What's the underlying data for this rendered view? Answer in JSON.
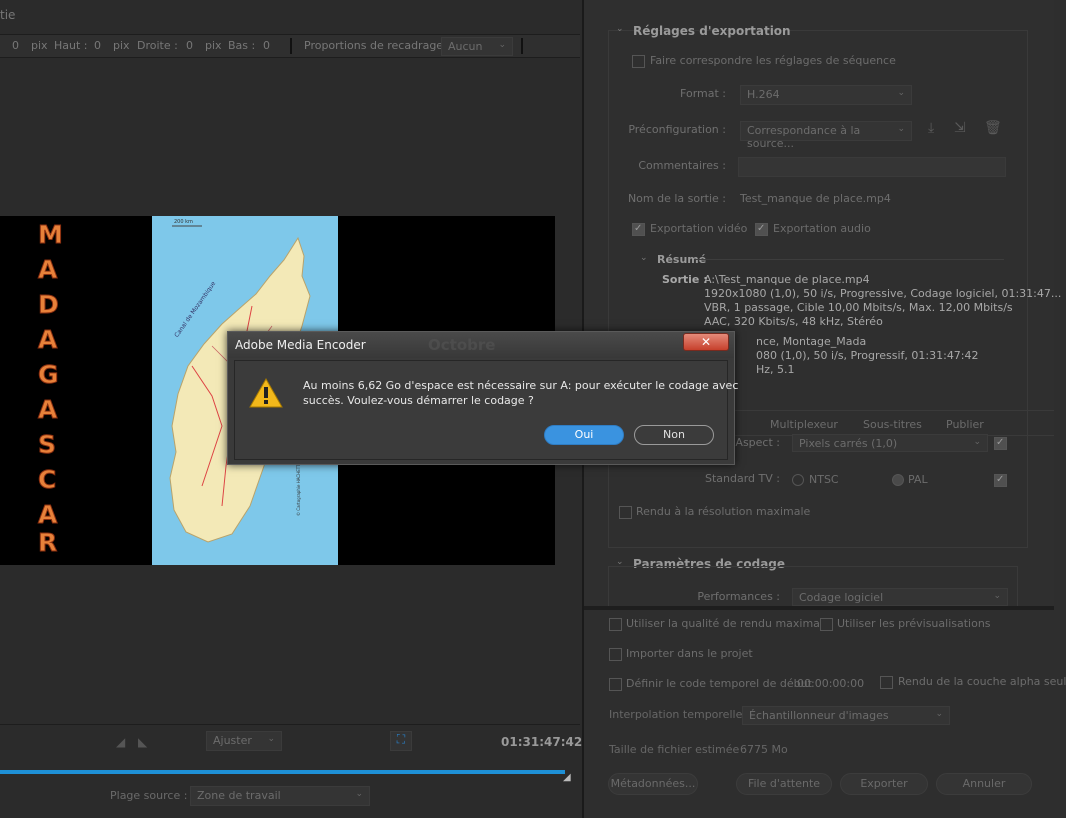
{
  "left_panel": {
    "title_fragment": "tie",
    "crop": {
      "left_value": "0",
      "unit": "pix",
      "top_label": "Haut :",
      "top_value": "0",
      "right_label": "Droite :",
      "right_value": "0",
      "bottom_label": "Bas :",
      "bottom_value": "0",
      "proportions_label": "Proportions de recadrage :",
      "proportions_value": "Aucun"
    },
    "poster_letters": [
      "M",
      "A",
      "D",
      "A",
      "G",
      "A",
      "S",
      "C",
      "A",
      "R"
    ],
    "map_scale_label": "200 km",
    "map_sea_label": "Canal de Mozambique",
    "map_credit": "© Cartographie HACHETTE Tourisme",
    "controls": {
      "fit_value": "Ajuster",
      "timecode": "01:31:47:42",
      "source_range_label": "Plage source :",
      "source_range_value": "Zone de travail"
    }
  },
  "export_settings": {
    "section_title": "Réglages d'exportation",
    "match_sequence_label": "Faire correspondre les réglages de séquence",
    "format_label": "Format :",
    "format_value": "H.264",
    "preset_label": "Préconfiguration :",
    "preset_value": "Correspondance à la source...",
    "comments_label": "Commentaires :",
    "output_name_label": "Nom de la sortie :",
    "output_name_value": "Test_manque de place.mp4",
    "export_video_label": "Exportation vidéo",
    "export_audio_label": "Exportation audio",
    "summary_title": "Résumé",
    "output_label": "Sortie :",
    "output_lines": [
      "A:\\Test_manque de place.mp4",
      "1920x1080 (1,0), 50 i/s, Progressive, Codage logiciel, 01:31:47...",
      "VBR, 1 passage, Cible 10,00  Mbits/s, Max. 12,00  Mbits/s",
      "AAC, 320  Kbits/s, 48  kHz, Stéréo"
    ],
    "source_lines": [
      "nce, Montage_Mada",
      "080 (1,0), 50  i/s, Progressif, 01:31:47:42",
      "Hz, 5.1"
    ],
    "tabs": [
      "Multiplexeur",
      "Sous-titres",
      "Publier"
    ],
    "aspect_label": "Aspect :",
    "aspect_value": "Pixels carrés (1,0)",
    "tv_standard_label": "Standard TV :",
    "ntsc_label": "NTSC",
    "pal_label": "PAL",
    "max_resolution_label": "Rendu à la résolution maximale",
    "encoding_title": "Paramètres de codage",
    "performance_label": "Performances :",
    "performance_value": "Codage logiciel"
  },
  "bottom_options": {
    "max_quality_label": "Utiliser la qualité de rendu maximale",
    "use_previews_label": "Utiliser les prévisualisations",
    "import_project_label": "Importer dans le projet",
    "start_timecode_label": "Définir le code temporel de début",
    "start_timecode_value": "00:00:00:00",
    "alpha_label": "Rendu de la couche alpha seule",
    "interp_label": "Interpolation temporelle :",
    "interp_value": "Échantillonneur d'images",
    "filesize_label": "Taille de fichier estimée :",
    "filesize_value": "6775 Mo",
    "buttons": {
      "metadata": "Métadonnées...",
      "queue": "File d'attente",
      "export": "Exporter",
      "cancel": "Annuler"
    }
  },
  "dialog": {
    "title": "Adobe Media Encoder",
    "close_glyph": "✕",
    "message_line1": "Au moins 6,62 Go d'espace est nécessaire sur A: pour exécuter le codage avec",
    "message_line2": "succès. Voulez-vous démarrer le codage ?",
    "yes_label": "Oui",
    "no_label": "Non",
    "background_fragment": "Octobre",
    "colors": {
      "yes_button": "#3a93e0",
      "warning": "#f2b81b"
    }
  }
}
